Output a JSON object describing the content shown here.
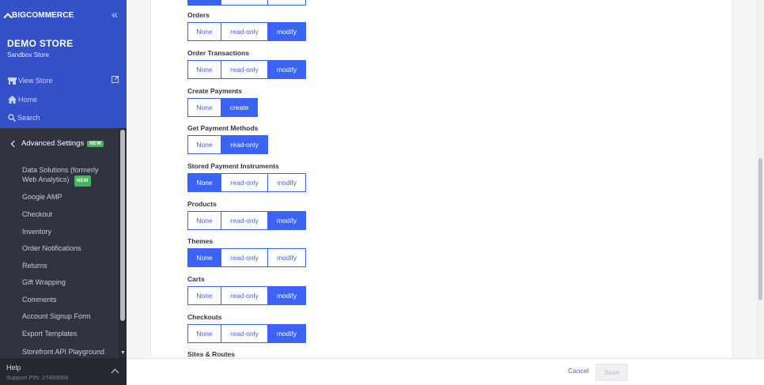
{
  "brand": {
    "logo_text": "BIGCOMMERCE"
  },
  "store": {
    "name": "DEMO STORE",
    "subtitle": "Sandbox Store"
  },
  "sidebar": {
    "links": [
      {
        "label": "View Store",
        "icon": "store-icon"
      },
      {
        "label": "Home",
        "icon": "home-icon"
      },
      {
        "label": "Search",
        "icon": "search-icon"
      }
    ],
    "section": {
      "label": "Advanced Settings",
      "badge": "NEW"
    },
    "items": [
      {
        "label": "Data Solutions (formerly Web Analytics)",
        "badge": "NEW"
      },
      {
        "label": "Google AMP"
      },
      {
        "label": "Checkout"
      },
      {
        "label": "Inventory"
      },
      {
        "label": "Order Notifications"
      },
      {
        "label": "Returns"
      },
      {
        "label": "Gift Wrapping"
      },
      {
        "label": "Comments"
      },
      {
        "label": "Account Signup Form"
      },
      {
        "label": "Export Templates"
      },
      {
        "label": "Storefront API Playground"
      }
    ],
    "help": {
      "title": "Help",
      "support_pin": "Support PIN: 27459568"
    }
  },
  "permissions": [
    {
      "label": "Orders",
      "options": [
        "None",
        "read-only",
        "modify"
      ],
      "selected": "modify"
    },
    {
      "label": "Order Transactions",
      "options": [
        "None",
        "read-only",
        "modify"
      ],
      "selected": "modify"
    },
    {
      "label": "Create Payments",
      "options": [
        "None",
        "create"
      ],
      "selected": "create"
    },
    {
      "label": "Get Payment Methods",
      "options": [
        "None",
        "read-only"
      ],
      "selected": "read-only"
    },
    {
      "label": "Stored Payment Instruments",
      "options": [
        "None",
        "read-only",
        "modify"
      ],
      "selected": "None"
    },
    {
      "label": "Products",
      "options": [
        "None",
        "read-only",
        "modify"
      ],
      "selected": "modify"
    },
    {
      "label": "Themes",
      "options": [
        "None",
        "read-only",
        "modify"
      ],
      "selected": "None"
    },
    {
      "label": "Carts",
      "options": [
        "None",
        "read-only",
        "modify"
      ],
      "selected": "modify"
    },
    {
      "label": "Checkouts",
      "options": [
        "None",
        "read-only",
        "modify"
      ],
      "selected": "modify"
    },
    {
      "label": "Sites & Routes",
      "options": [],
      "selected": ""
    }
  ],
  "footer": {
    "cancel_label": "Cancel",
    "save_label": "Save"
  },
  "colors": {
    "accent": "#3c64f4",
    "sidebar_top": "#3451c9",
    "sidebar_bg": "#313440",
    "badge": "#41b85a"
  }
}
